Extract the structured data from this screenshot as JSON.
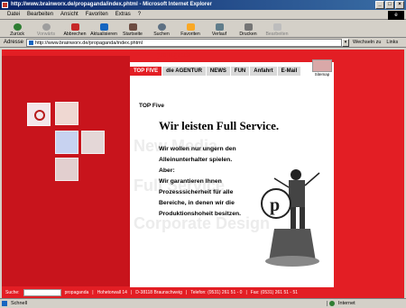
{
  "window": {
    "title": "http://www.brainworx.de/propaganda/index.phtml - Microsoft Internet Explorer"
  },
  "menubar": [
    "Datei",
    "Bearbeiten",
    "Ansicht",
    "Favoriten",
    "Extras",
    "?"
  ],
  "toolbar": {
    "back": "Zurück",
    "forward": "Vorwärts",
    "stop": "Abbrechen",
    "refresh": "Aktualisieren",
    "home": "Startseite",
    "search": "Suchen",
    "favorites": "Favoriten",
    "history": "Verlauf",
    "print": "Drucken",
    "edit": "Bearbeiten"
  },
  "address": {
    "label": "Adresse",
    "url": "http://www.brainworx.de/propaganda/index.phtml",
    "go": "Wechseln zu",
    "links": "Links"
  },
  "site": {
    "brand": "propaganda",
    "nav": [
      "TOP FIVE",
      "die AGENTUR",
      "NEWS",
      "FUN",
      "Anfahrt",
      "E-Mail"
    ],
    "sitemap": "Sitemap",
    "section": "TOP Five",
    "headline": "Wir leisten Full Service.",
    "body_lines": [
      "Wir wollen nur ungern den",
      "Alleinunterhalter spielen.",
      "Aber:",
      "Wir garantieren Ihnen",
      "Prozesssicherheit für alle",
      "Bereiche, in denen wir die",
      "Produktionshoheit besitzen."
    ],
    "watermarks": [
      "New Media",
      "Full Service",
      "Corporate Design"
    ],
    "footer": {
      "search_label": "Suche:",
      "segments": [
        "propaganda",
        "Hohetorwall 14",
        "D-38118 Braunschweig",
        "Telefon: (0531) 261 51 - 0",
        "Fax: (0531) 261 51 - 51"
      ]
    }
  },
  "statusbar": {
    "left": "Schnell",
    "zone": "Internet"
  }
}
